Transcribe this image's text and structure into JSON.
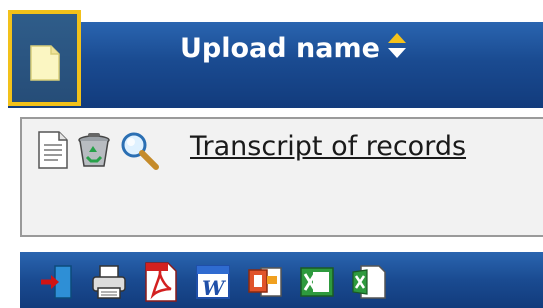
{
  "header": {
    "column_title": "Upload name",
    "new_document_icon": "blank-document-icon",
    "sort_icon": "sort-up-down-icon",
    "highlight_color": "#f2c11a",
    "bar_color": "#1a4b91"
  },
  "row": {
    "icons": [
      "document-icon",
      "recycle-bin-icon",
      "magnifier-icon"
    ],
    "file_name": "Transcript of records"
  },
  "footer": {
    "tools": [
      "exit-door-icon",
      "printer-icon",
      "pdf-export-icon",
      "word-export-icon",
      "powerpoint-export-icon",
      "excel-export-icon",
      "excel-alt-export-icon"
    ]
  }
}
